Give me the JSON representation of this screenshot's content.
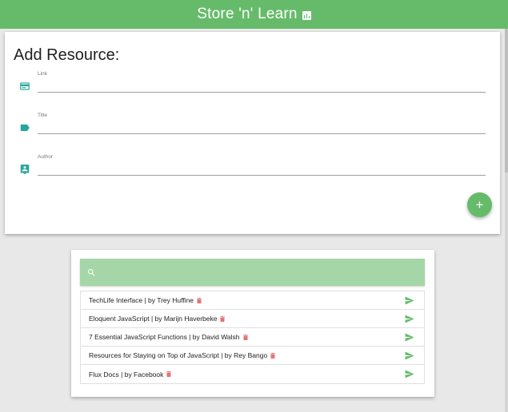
{
  "header": {
    "title": "Store 'n' Learn",
    "icon": "bar-chart-icon",
    "color": "#66bb6a"
  },
  "form": {
    "heading": "Add Resource:",
    "fields": [
      {
        "label": "Link",
        "value": "",
        "icon": "credit-card-icon"
      },
      {
        "label": "Title",
        "value": "",
        "icon": "label-tag-icon"
      },
      {
        "label": "Author",
        "value": "",
        "icon": "contact-card-icon"
      }
    ],
    "add_button": "+",
    "icon_color": "#26a69a"
  },
  "search": {
    "placeholder": "",
    "value": "",
    "icon": "search-icon",
    "bar_color": "#a5d6a7"
  },
  "resources": [
    {
      "text": "TechLife Interface | by Trey Huffine"
    },
    {
      "text": "Eloquent JavaScript | by Marijn Haverbeke"
    },
    {
      "text": "7 Essential JavaScript Functions | by David Walsh"
    },
    {
      "text": "Resources for Staying on Top of JavaScript | by Rey Bango"
    },
    {
      "text": "Flux Docs | by Facebook"
    }
  ],
  "colors": {
    "delete": "#e57373",
    "send": "#66bb6a"
  }
}
